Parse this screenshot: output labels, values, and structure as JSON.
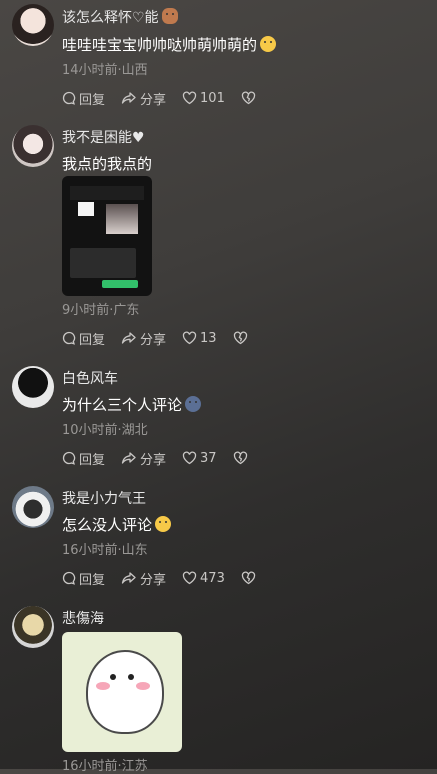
{
  "comments": [
    {
      "author": "该怎么释怀♡能",
      "author_emoji": "bear-emoji",
      "text": "哇哇哇宝宝帅帅哒帅萌帅萌的",
      "text_emoji": "yawning-face-emoji",
      "meta": "14小时前·山西",
      "reply_label": "回复",
      "share_label": "分享",
      "likes": "101"
    },
    {
      "author": "我不是困能♥",
      "text": "我点的我点的",
      "image": "chat-screenshot-thumbnail",
      "meta": "9小时前·广东",
      "reply_label": "回复",
      "share_label": "分享",
      "likes": "13"
    },
    {
      "author": "白色风车",
      "text": "为什么三个人评论",
      "text_emoji": "blue-face-emoji",
      "meta": "10小时前·湖北",
      "reply_label": "回复",
      "share_label": "分享",
      "likes": "37"
    },
    {
      "author": "我是小力气王",
      "text": "怎么没人评论",
      "text_emoji": "hushed-face-emoji",
      "meta": "16小时前·山东",
      "reply_label": "回复",
      "share_label": "分享",
      "likes": "473"
    },
    {
      "author": "悲傷海",
      "image": "cute-bear-sticker",
      "meta": "16小时前·江苏"
    }
  ],
  "colors": {
    "text": "#ffffff",
    "meta": "#9a9896",
    "action": "#c9c7c5"
  }
}
